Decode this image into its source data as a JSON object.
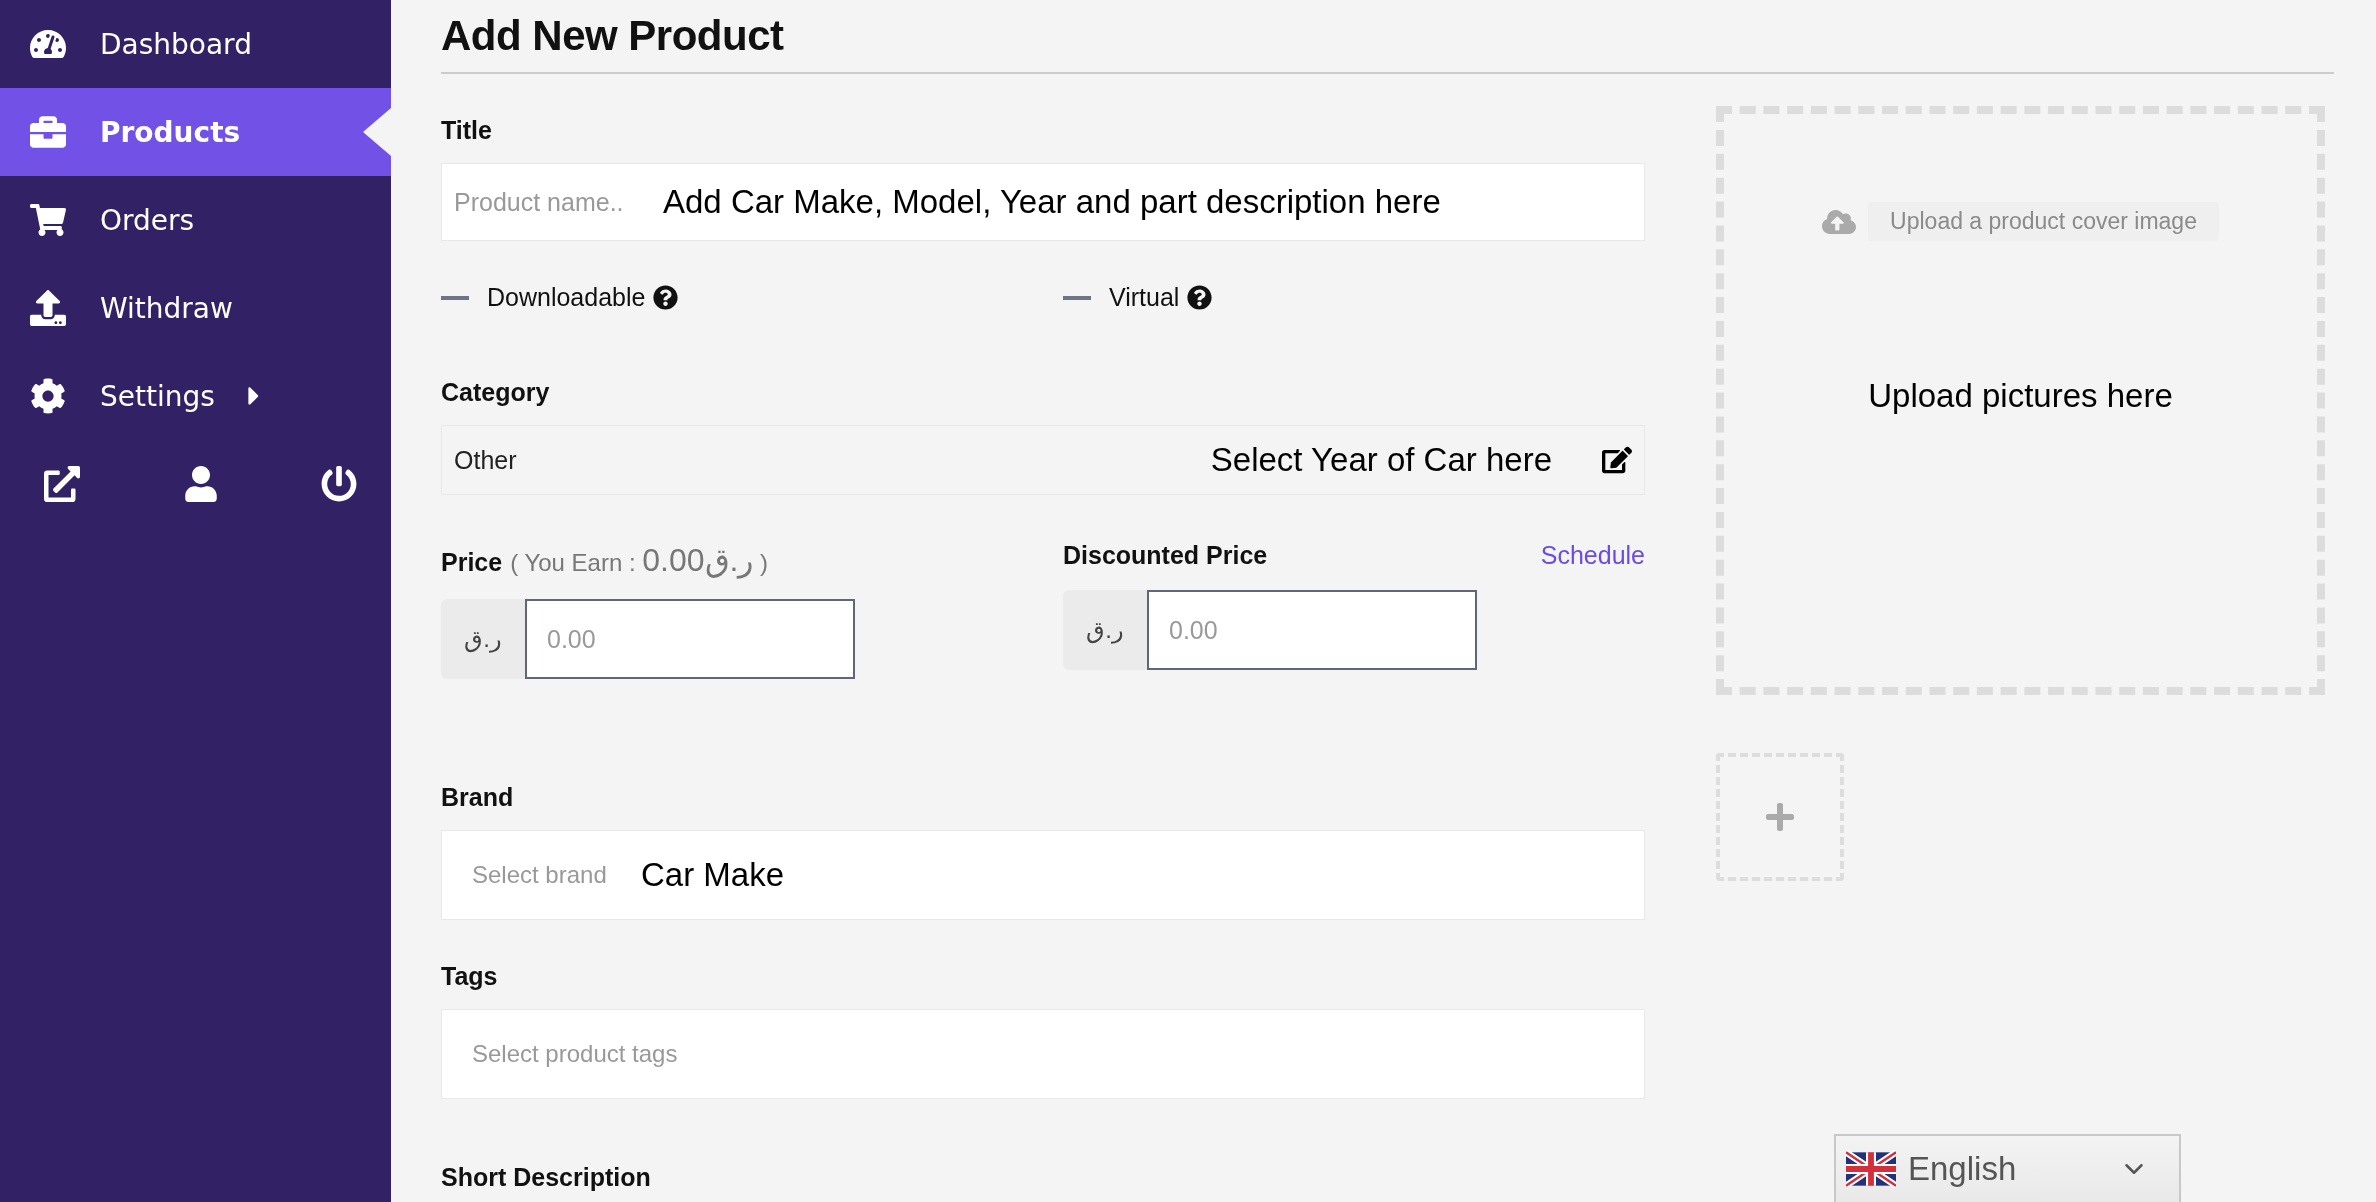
{
  "sidebar": {
    "items": [
      {
        "label": "Dashboard",
        "selected": false
      },
      {
        "label": "Products",
        "selected": true
      },
      {
        "label": "Orders",
        "selected": false
      },
      {
        "label": "Withdraw",
        "selected": false
      },
      {
        "label": "Settings",
        "selected": false,
        "expanded": false
      }
    ]
  },
  "page_title": "Add New Product",
  "title_field": {
    "label": "Title",
    "placeholder": "Product name..",
    "annotation": "Add Car Make, Model, Year and part description here"
  },
  "options": [
    {
      "label": "Downloadable",
      "checked": false
    },
    {
      "label": "Virtual",
      "checked": false
    }
  ],
  "category": {
    "label": "Category",
    "value": "Other",
    "annotation": "Select Year of Car here"
  },
  "price": {
    "label": "Price",
    "earn_note": "( You Earn : ",
    "earn_value": "0.00ر.ق",
    "earn_close": " )",
    "currency": "ر.ق",
    "placeholder": "0.00"
  },
  "discounted_price": {
    "label": "Discounted Price",
    "link": "Schedule",
    "currency": "ر.ق",
    "placeholder": "0.00"
  },
  "brand": {
    "label": "Brand",
    "placeholder": "Select brand",
    "annotation": "Car Make"
  },
  "tags": {
    "label": "Tags",
    "placeholder": "Select product tags"
  },
  "short_description": {
    "label": "Short Description"
  },
  "cover_upload": {
    "button": "Upload a product cover image",
    "annotation": "Upload pictures here"
  },
  "language": {
    "value": "English"
  }
}
